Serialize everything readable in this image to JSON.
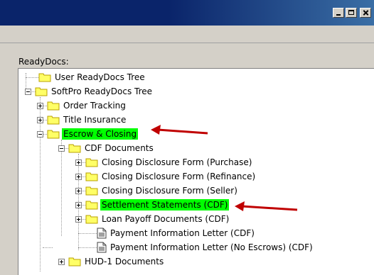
{
  "window": {
    "controls": {
      "minimize": "minimize",
      "maximize": "maximize",
      "close": "close"
    }
  },
  "panel": {
    "label": "ReadyDocs:"
  },
  "tree": [
    {
      "label": "User ReadyDocs Tree",
      "icon": "folder-icon",
      "expander": "none",
      "highlight": false
    },
    {
      "label": "SoftPro ReadyDocs Tree",
      "icon": "folder-icon",
      "expander": "minus",
      "highlight": false
    },
    {
      "label": "Order Tracking",
      "icon": "folder-icon",
      "expander": "plus",
      "highlight": false
    },
    {
      "label": "Title Insurance",
      "icon": "folder-icon",
      "expander": "plus",
      "highlight": false
    },
    {
      "label": "Escrow & Closing",
      "icon": "folder-icon",
      "expander": "minus",
      "highlight": true
    },
    {
      "label": "CDF Documents",
      "icon": "folder-icon",
      "expander": "minus",
      "highlight": false
    },
    {
      "label": "Closing Disclosure Form (Purchase)",
      "icon": "folder-icon",
      "expander": "plus",
      "highlight": false
    },
    {
      "label": "Closing Disclosure Form (Refinance)",
      "icon": "folder-icon",
      "expander": "plus",
      "highlight": false
    },
    {
      "label": "Closing Disclosure Form (Seller)",
      "icon": "folder-icon",
      "expander": "plus",
      "highlight": false
    },
    {
      "label": "Settlement Statements (CDF)",
      "icon": "folder-icon",
      "expander": "plus",
      "highlight": true
    },
    {
      "label": "Loan Payoff Documents (CDF)",
      "icon": "folder-icon",
      "expander": "plus",
      "highlight": false
    },
    {
      "label": "Payment Information Letter (CDF)",
      "icon": "document-icon",
      "expander": "none",
      "highlight": false
    },
    {
      "label": "Payment Information Letter (No Escrows) (CDF)",
      "icon": "document-icon",
      "expander": "none",
      "highlight": false
    },
    {
      "label": "HUD-1 Documents",
      "icon": "folder-icon",
      "expander": "plus",
      "highlight": false
    }
  ],
  "colors": {
    "highlight": "#00ff00",
    "arrow": "#c00000",
    "folder_fill": "#ffff66",
    "folder_stroke": "#b8a000"
  }
}
